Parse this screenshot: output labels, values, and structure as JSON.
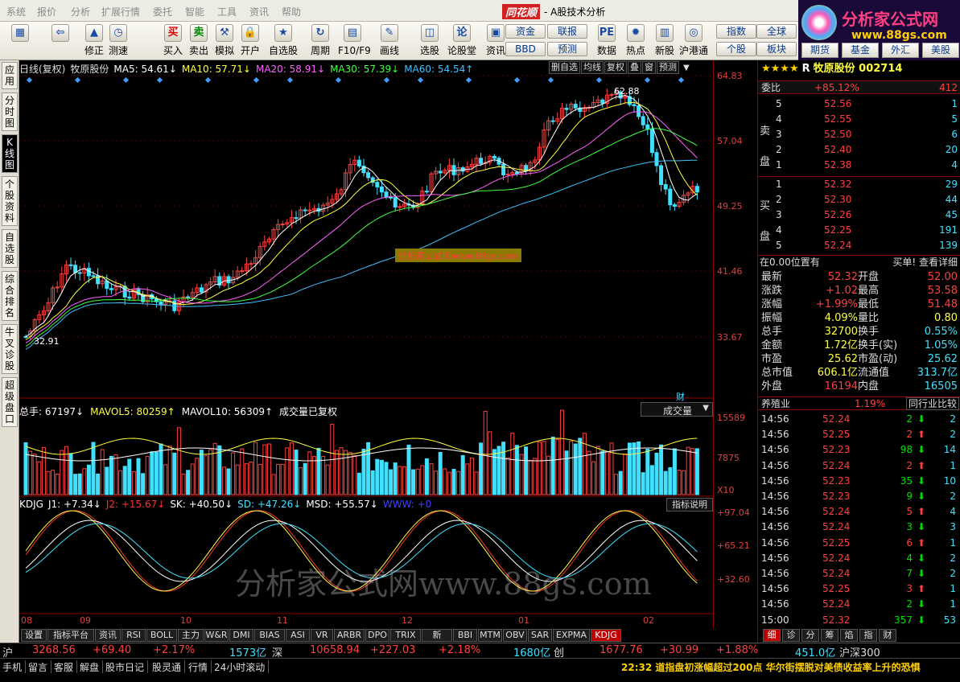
{
  "menu": [
    "系统",
    "报价",
    "分析",
    "扩展行情",
    "委托",
    "智能",
    "工具",
    "资讯",
    "帮助"
  ],
  "app_brand": "同花顺",
  "window_title": "- A股技术分析",
  "logo": {
    "title": "分析家公式网",
    "url": "www.88gs.com"
  },
  "toolbar": [
    {
      "label": "",
      "icon": "grid-icon"
    },
    {
      "label": "",
      "icon": "back-icon"
    },
    {
      "label": "修正",
      "icon": "up-arrow-icon"
    },
    {
      "label": "测速",
      "icon": "clock-icon"
    },
    {
      "label": "买入",
      "icon": "buy-icon",
      "glyph": "买"
    },
    {
      "label": "卖出",
      "icon": "sell-icon",
      "glyph": "卖"
    },
    {
      "label": "模拟",
      "icon": "hammer-icon"
    },
    {
      "label": "开户",
      "icon": "lock-icon"
    },
    {
      "label": "自选股",
      "icon": "star-icon"
    },
    {
      "label": "周期",
      "icon": "cycle-icon"
    },
    {
      "label": "F10/F9",
      "icon": "f10-icon"
    },
    {
      "label": "画线",
      "icon": "pen-icon"
    },
    {
      "label": "选股",
      "icon": "select-icon"
    },
    {
      "label": "论股堂",
      "icon": "forum-icon",
      "glyph": "论"
    },
    {
      "label": "资讯",
      "icon": "news-icon"
    },
    {
      "label": "数据",
      "icon": "pe-icon",
      "glyph": "PE"
    },
    {
      "label": "热点",
      "icon": "hot-icon"
    },
    {
      "label": "新股",
      "icon": "new-stock-icon"
    },
    {
      "label": "沪港通",
      "icon": "hk-icon"
    }
  ],
  "quick_buttons": [
    [
      "资金",
      "联报",
      "指数",
      "全球"
    ],
    [
      "BBD",
      "预测",
      "个股",
      "板块"
    ]
  ],
  "quick_right": [
    "期货",
    "基金",
    "外汇",
    "美股"
  ],
  "left_tabs": [
    "应用",
    "分时图",
    "K线图",
    "个股资料",
    "自选股",
    "综合排名",
    "牛叉诊股",
    "超级盘口"
  ],
  "chart_header": {
    "prefix": "日线(复权)",
    "stock": "牧原股份",
    "ma": [
      {
        "label": "MA5: 54.61↓",
        "color": "#ffffff"
      },
      {
        "label": "MA10: 57.71↓",
        "color": "#ffff40"
      },
      {
        "label": "MA20: 58.91↓",
        "color": "#ff60ff"
      },
      {
        "label": "MA30: 57.39↓",
        "color": "#40ff40"
      },
      {
        "label": "MA60: 54.54↑",
        "color": "#40c0ff"
      }
    ],
    "buttons": [
      "删自选",
      "均线",
      "复权",
      "叠",
      "窗",
      "预测"
    ]
  },
  "price_labels": {
    "high": "62.88",
    "low": "32.91"
  },
  "watermark_box": "分析家公式网www.88gs.com",
  "big_watermark": "分析家公式网www.88gs.com",
  "fin_marker": "财",
  "vol_header": {
    "items": [
      {
        "label": "总手: 67197↓",
        "color": "#ffffff"
      },
      {
        "label": "MAVOL5: 80259↑",
        "color": "#ffff40"
      },
      {
        "label": "MAVOL10: 56309↑",
        "color": "#ffffff"
      },
      {
        "label": "成交量已复权",
        "color": "#ffffff"
      }
    ],
    "dropdown": "成交量"
  },
  "ind_header": {
    "items": [
      {
        "label": "KDJG",
        "color": "#ffffff"
      },
      {
        "label": "J1: +7.34↓",
        "color": "#ffffff"
      },
      {
        "label": "J2: +15.67↓",
        "color": "#ff3030"
      },
      {
        "label": "SK: +40.50↓",
        "color": "#ffffff"
      },
      {
        "label": "SD: +47.26↓",
        "color": "#40e0ff"
      },
      {
        "label": "MSD: +55.57↓",
        "color": "#ffffff"
      },
      {
        "label": "WWW: +0",
        "color": "#4040ff"
      }
    ],
    "button": "指标说明"
  },
  "axis_price": [
    "64.83",
    "57.04",
    "49.25",
    "41.46",
    "33.67"
  ],
  "axis_vol": [
    "15589",
    "7875",
    "X10"
  ],
  "axis_ind": [
    "+97.04",
    "+65.21",
    "+32.60"
  ],
  "x_labels": [
    "08",
    "09",
    "10",
    "11",
    "12",
    "01",
    "02"
  ],
  "bottom_tabs": [
    "设置",
    "指标平台",
    "资讯",
    "RSI",
    "BOLL",
    "主力",
    "W&R",
    "DMI",
    "BIAS",
    "ASI",
    "VR",
    "ARBR",
    "DPO",
    "TRIX",
    "新DMA",
    "BBI",
    "MTM",
    "OBV",
    "SAR",
    "EXPMA",
    "KDJG"
  ],
  "quote": {
    "title": "牧原股份 002714",
    "stars": "★★★★",
    "r": "R",
    "weibi": {
      "label": "委比",
      "pct": "+85.12%",
      "val": "412"
    },
    "sell_label": "卖盘",
    "buy_label": "买盘",
    "sell": [
      [
        "5",
        "52.56",
        "1"
      ],
      [
        "4",
        "52.55",
        "5"
      ],
      [
        "3",
        "52.50",
        "6"
      ],
      [
        "2",
        "52.40",
        "20"
      ],
      [
        "1",
        "52.38",
        "4"
      ]
    ],
    "buy": [
      [
        "1",
        "52.32",
        "29"
      ],
      [
        "2",
        "52.30",
        "44"
      ],
      [
        "3",
        "52.26",
        "45"
      ],
      [
        "4",
        "52.25",
        "191"
      ],
      [
        "5",
        "52.24",
        "139"
      ]
    ],
    "pos_text": "在0.00位置有",
    "pos_right": "买单! 查看详细",
    "stats": [
      [
        "最新",
        "52.32",
        "开盘",
        "52.00"
      ],
      [
        "涨跌",
        "+1.02",
        "最高",
        "53.58"
      ],
      [
        "涨幅",
        "+1.99%",
        "最低",
        "51.48"
      ],
      [
        "振幅",
        "4.09%",
        "量比",
        "0.80"
      ],
      [
        "总手",
        "32700",
        "换手",
        "0.55%"
      ],
      [
        "金额",
        "1.72亿",
        "换手(实)",
        "1.05%"
      ],
      [
        "市盈",
        "25.62",
        "市盈(动)",
        "25.62"
      ],
      [
        "总市值",
        "606.1亿",
        "流通值",
        "313.7亿"
      ],
      [
        "外盘",
        "16194",
        "内盘",
        "16505"
      ]
    ],
    "industry": {
      "name": "养殖业",
      "pct": "1.19%",
      "btn": "同行业比较"
    },
    "ticks": [
      [
        "14:56",
        "52.24",
        "2",
        "down",
        "2"
      ],
      [
        "14:56",
        "52.25",
        "2",
        "up",
        "2"
      ],
      [
        "14:56",
        "52.23",
        "98",
        "down",
        "14"
      ],
      [
        "14:56",
        "52.24",
        "2",
        "up",
        "1"
      ],
      [
        "14:56",
        "52.23",
        "35",
        "down",
        "10"
      ],
      [
        "14:56",
        "52.23",
        "9",
        "down",
        "2"
      ],
      [
        "14:56",
        "52.24",
        "5",
        "up",
        "4"
      ],
      [
        "14:56",
        "52.24",
        "3",
        "down",
        "3"
      ],
      [
        "14:56",
        "52.25",
        "6",
        "up",
        "1"
      ],
      [
        "14:56",
        "52.24",
        "4",
        "down",
        "2"
      ],
      [
        "14:56",
        "52.24",
        "7",
        "down",
        "2"
      ],
      [
        "14:56",
        "52.25",
        "3",
        "up",
        "1"
      ],
      [
        "14:56",
        "52.24",
        "2",
        "down",
        "1"
      ],
      [
        "15:00",
        "52.32",
        "357",
        "down",
        "53"
      ]
    ],
    "tabs": [
      "细",
      "诊",
      "分",
      "筹",
      "焰",
      "指",
      "财"
    ]
  },
  "status": {
    "sh_label": "沪",
    "sh_val": "3268.56",
    "sh_chg": "+69.40",
    "sh_pct": "+2.17%",
    "sh_amt": "1573亿",
    "sz_label": "深",
    "sz_val": "10658.94",
    "sz_chg": "+227.03",
    "sz_pct": "+2.18%",
    "sz_amt": "1680亿",
    "cy_label": "创",
    "cy_val": "1677.76",
    "cy_chg": "+30.99",
    "cy_pct": "+1.88%",
    "hs_amt": "451.0亿",
    "hs_label": "沪深300"
  },
  "taskbar": {
    "items": [
      "手机",
      "留言",
      "客服",
      "解盘",
      "股市日记",
      "股灵通",
      "行情",
      "24小时滚动"
    ],
    "news": "22:32 道指盘初涨幅超过200点 华尔街摆脱对美债收益率上升的恐惧"
  }
}
